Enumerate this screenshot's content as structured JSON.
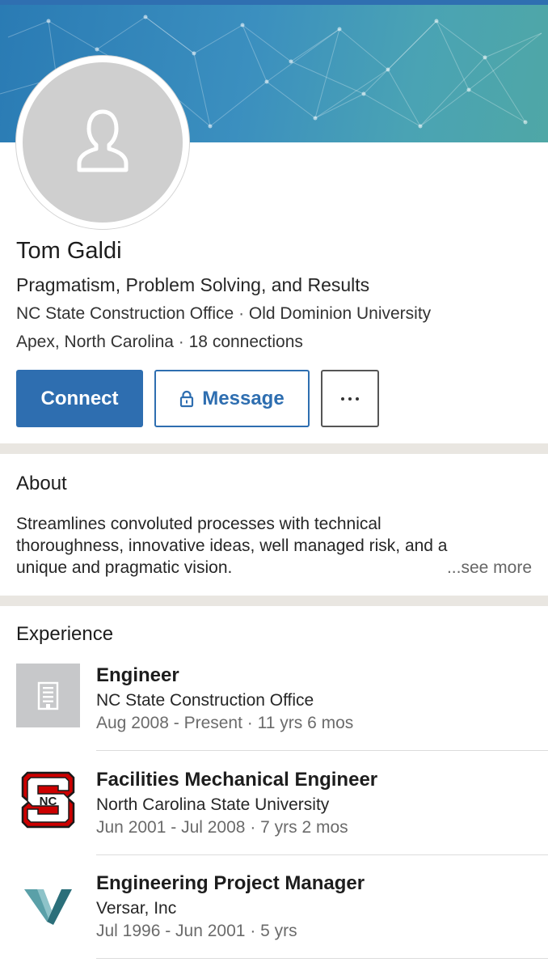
{
  "profile": {
    "name": "Tom Galdi",
    "headline": "Pragmatism, Problem Solving, and Results",
    "current_company": "NC State Construction Office",
    "education": "Old Dominion University",
    "location": "Apex, North Carolina",
    "connections": "18 connections",
    "separator": "·"
  },
  "actions": {
    "connect_label": "Connect",
    "message_label": "Message",
    "more_icon": "ellipsis-icon"
  },
  "about": {
    "title": "About",
    "lines": [
      "Streamlines convoluted processes with technical",
      "thoroughness, innovative ideas, well managed risk, and a",
      "unique and pragmatic vision."
    ],
    "see_more": "...see more"
  },
  "experience": {
    "title": "Experience",
    "items": [
      {
        "title": "Engineer",
        "company": "NC State Construction Office",
        "dates": "Aug 2008 - Present",
        "duration": "11 yrs 6 mos",
        "logo": "building-icon"
      },
      {
        "title": "Facilities Mechanical Engineer",
        "company": "North Carolina State University",
        "dates": "Jun 2001 - Jul 2008",
        "duration": "7 yrs 2 mos",
        "logo": "ncsu-logo"
      },
      {
        "title": "Engineering Project Manager",
        "company": "Versar, Inc",
        "dates": "Jul 1996 - Jun 2001",
        "duration": "5 yrs",
        "logo": "versar-logo"
      }
    ]
  },
  "colors": {
    "brand_blue": "#2e6eb0",
    "ncsu_red": "#cc0000",
    "versar_teal": "#2b7c86"
  }
}
